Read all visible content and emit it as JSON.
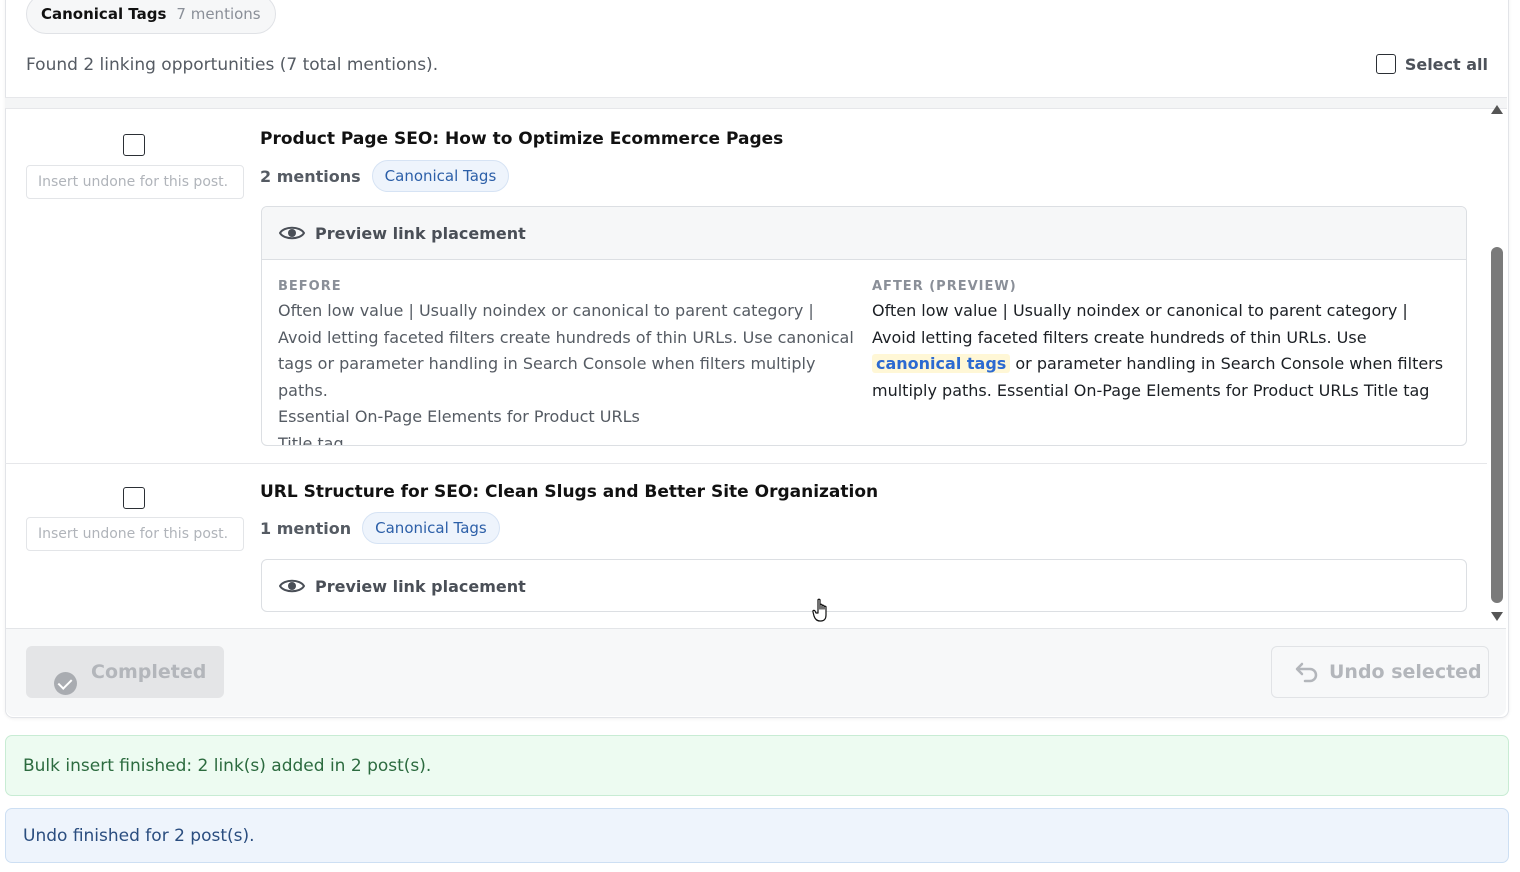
{
  "header": {
    "tag_label": "Canonical Tags",
    "tag_count": "7 mentions",
    "summary": "Found 2 linking opportunities (7 total mentions).",
    "select_all": "Select all"
  },
  "posts": [
    {
      "title": "Product Page SEO: How to Optimize Ecommerce Pages",
      "input_placeholder": "Insert undone for this post.",
      "mentions": "2 mentions",
      "tag": "Canonical Tags",
      "preview_label": "Preview link placement",
      "before_label": "BEFORE",
      "before_lines": [
        "Often low value | Usually noindex or canonical to parent category |",
        "Avoid letting faceted filters create hundreds of thin URLs. Use canonical",
        "tags or parameter handling in Search Console when filters multiply paths.",
        "Essential On-Page Elements for Product URLs",
        "Title tag"
      ],
      "after_label": "AFTER (PREVIEW)",
      "after_pre": "Often low value | Usually noindex or canonical to parent category | Avoid letting faceted filters create hundreds of thin URLs. Use",
      "after_link": "canonical tags",
      "after_post": "or parameter handling in Search Console when filters multiply paths. Essential On-Page Elements for Product URLs Title tag"
    },
    {
      "title": "URL Structure for SEO: Clean Slugs and Better Site Organization",
      "input_placeholder": "Insert undone for this post.",
      "mentions": "1 mention",
      "tag": "Canonical Tags",
      "preview_label": "Preview link placement"
    }
  ],
  "footer": {
    "completed": "Completed",
    "undo_selected": "Undo selected"
  },
  "alerts": {
    "success": "Bulk insert finished: 2 link(s) added in 2 post(s).",
    "info": "Undo finished for 2 post(s)."
  },
  "colors": {
    "accent": "#2c6ad1",
    "tag_text": "#2c5fa8",
    "success_bg": "#edfbf1",
    "info_bg": "#eef4fc"
  },
  "icons": [
    "eye-icon",
    "check-circle-icon",
    "undo-icon",
    "scroll-up-arrow-icon",
    "scroll-down-arrow-icon",
    "cursor-icon"
  ]
}
